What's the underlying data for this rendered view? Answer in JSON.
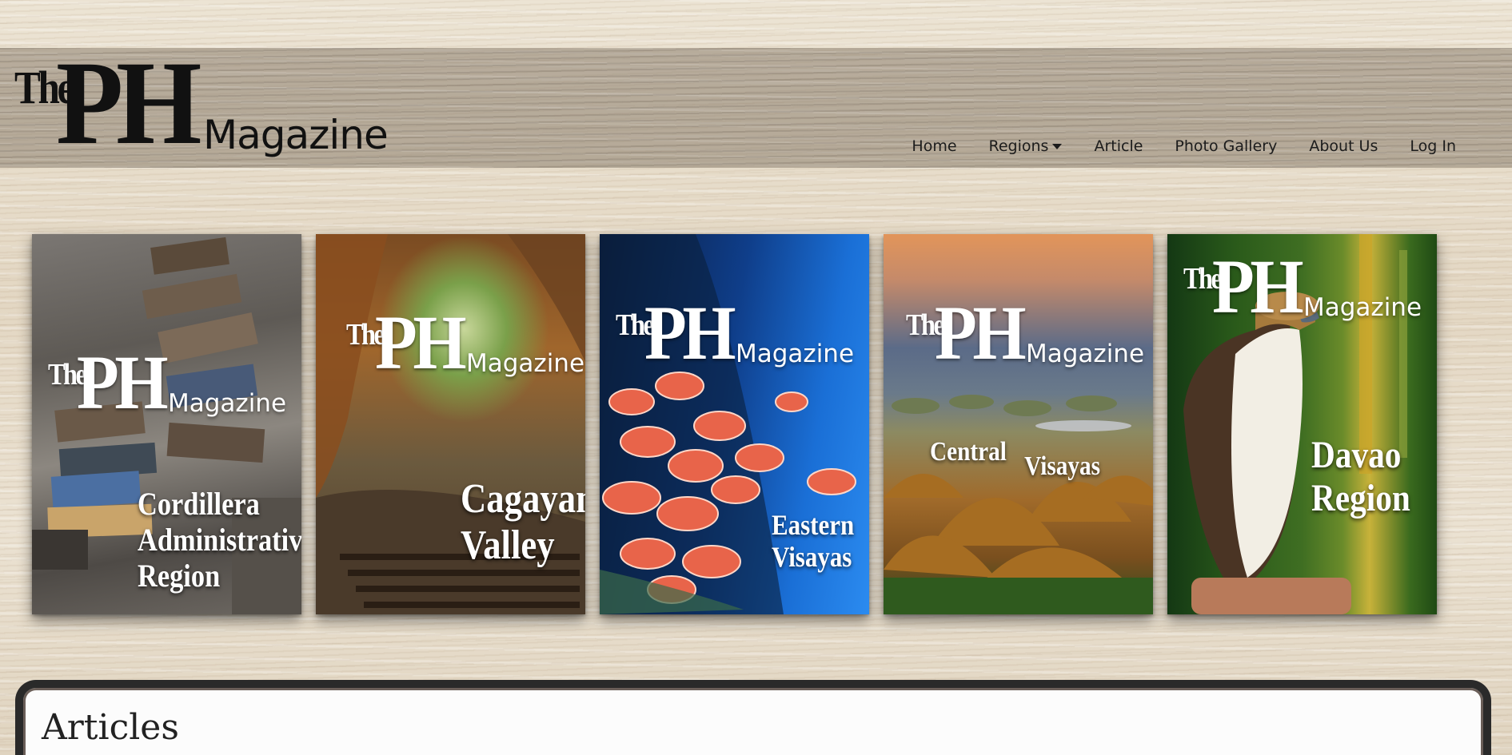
{
  "site": {
    "logo": {
      "the": "The",
      "ph": "PH",
      "magazine": "Magazine"
    }
  },
  "nav": {
    "items": [
      {
        "label": "Home"
      },
      {
        "label": "Regions",
        "dropdown": true
      },
      {
        "label": "Article"
      },
      {
        "label": "Photo Gallery"
      },
      {
        "label": "About Us"
      },
      {
        "label": "Log In"
      }
    ]
  },
  "covers": [
    {
      "region": [
        "Cordillera",
        "Administrative",
        "Region"
      ],
      "logo": {
        "the": "The",
        "ph": "PH",
        "magazine": "Magazine"
      }
    },
    {
      "region": [
        "Cagayan",
        "Valley"
      ],
      "logo": {
        "the": "The",
        "ph": "PH",
        "magazine": "Magazine"
      }
    },
    {
      "region": [
        "Eastern",
        "Visayas"
      ],
      "logo": {
        "the": "The",
        "ph": "PH",
        "magazine": "Magazine"
      }
    },
    {
      "region": [
        "Central",
        "Visayas"
      ],
      "logo": {
        "the": "The",
        "ph": "PH",
        "magazine": "Magazine"
      }
    },
    {
      "region": [
        "Davao",
        "Region"
      ],
      "logo": {
        "the": "The",
        "ph": "PH",
        "magazine": "Magazine"
      }
    }
  ],
  "articles": {
    "title": "Articles"
  }
}
